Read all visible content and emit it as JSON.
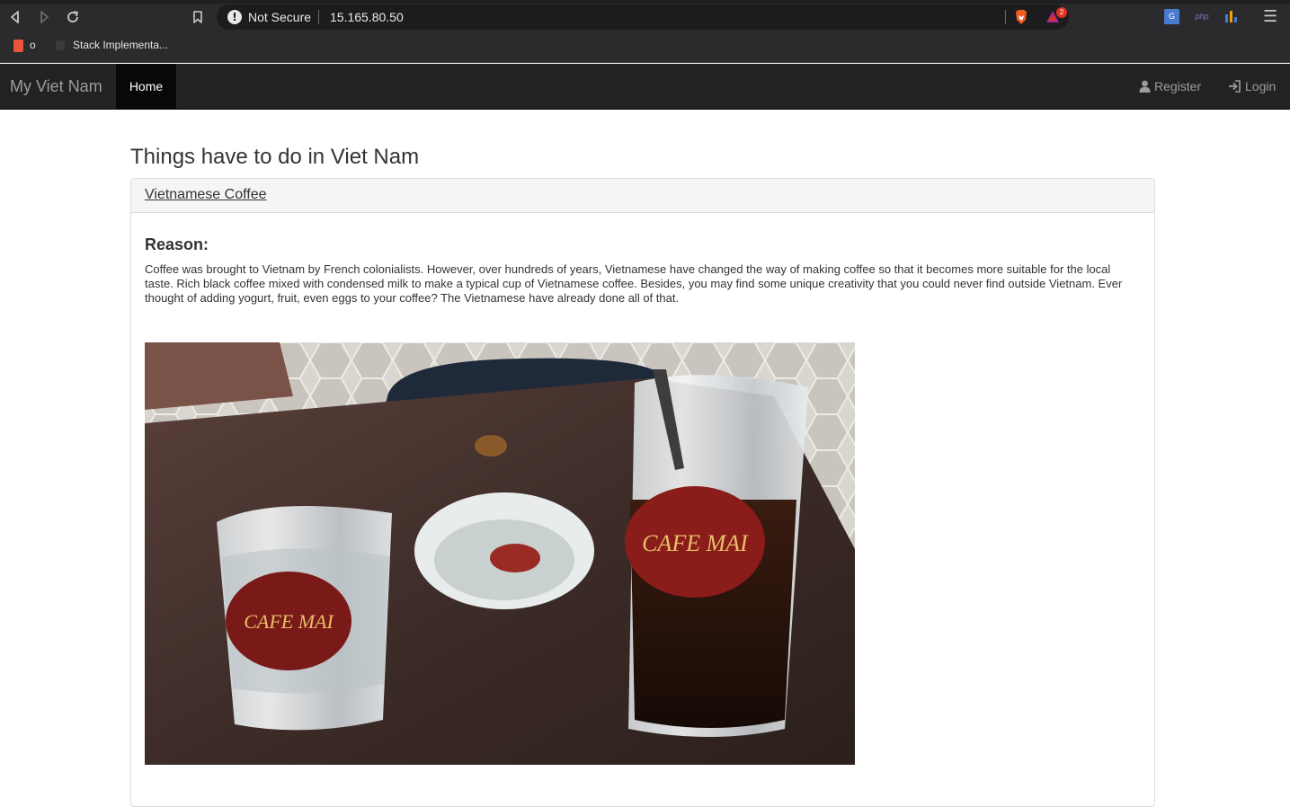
{
  "browser": {
    "secure_label": "Not Secure",
    "url": "15.165.80.50",
    "rewards_count": "2",
    "bookmarks": [
      {
        "label": "o"
      },
      {
        "label": "Stack Implementa..."
      }
    ],
    "extensions": [
      "translate-icon",
      "php-icon",
      "stats-icon"
    ]
  },
  "navbar": {
    "brand": "My Viet Nam",
    "home": "Home",
    "register": "Register",
    "login": "Login"
  },
  "main": {
    "heading": "Things have to do in Viet Nam",
    "panel": {
      "title": "Vietnamese Coffee",
      "reason_heading": "Reason:",
      "reason_text": "Coffee was brought to Vietnam by French colonialists. However, over hundreds of years, Vietnamese have changed the way of making coffee so that it becomes more suitable for the local taste. Rich black coffee mixed with condensed milk to make a typical cup of Vietnamese coffee. Besides, you may find some unique creativity that you could never find outside Vietnam. Ever thought of adding yogurt, fruit, even eggs to your coffee? The Vietnamese have already done all of that.",
      "photo_label": "CAFE MAI"
    }
  },
  "colors": {
    "navbar_bg": "#222222",
    "navbar_active": "#080808",
    "panel_border": "#dddddd",
    "text": "#333333"
  }
}
